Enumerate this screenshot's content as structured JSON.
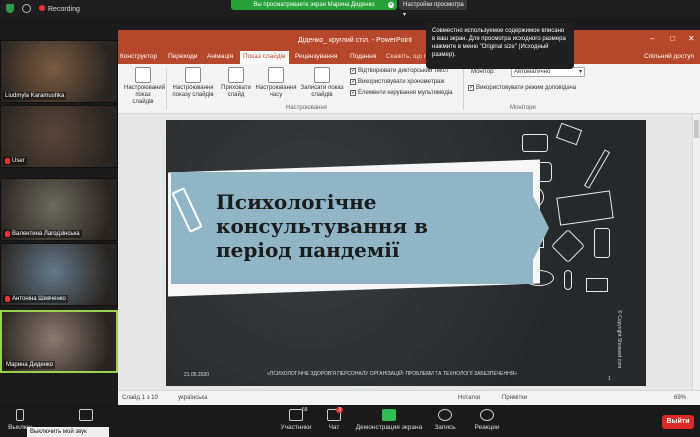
{
  "zoom_top": {
    "recording": "Recording",
    "share_notice": "Вы просматриваете экран Марина Диденко",
    "view_options": "Настройки просмотра"
  },
  "tooltip": "Совместно используемое содержимое вписано в ваш экран. Для просмотра исходного размера нажмите в меню \"Original size\" (Исходный размер).",
  "participants": [
    {
      "name": "Liudmyla Karamushka",
      "muted": false,
      "bg": "#7a5b42"
    },
    {
      "name": "User",
      "muted": true,
      "bg": "#5a4638"
    },
    {
      "name": "Валентина Лагодзінська",
      "muted": true,
      "bg": "#6c6a5e"
    },
    {
      "name": "Антоніна Шевченко",
      "muted": true,
      "bg": "#62798a"
    },
    {
      "name": "Марина Диденко",
      "muted": false,
      "bg": "#8c7a6e"
    }
  ],
  "ppt": {
    "title": "Діденко_ круглий стіл. - PowerPoint",
    "tabs": [
      "Конструктор",
      "Переходи",
      "Анімація",
      "Показ слайдів",
      "Рецензування",
      "Подання",
      "Скажіть, що потрібно зробити"
    ],
    "selected_tab": "Показ слайдів",
    "share": "Спільний доступ",
    "ribbon_buttons": [
      "Настроюваний показ слайдів",
      "Настроювання показу слайдів",
      "Приховати слайд",
      "Настроювання часу",
      "Записати показ слайдів"
    ],
    "checks": [
      {
        "label": "Відтворювати дикторський текст",
        "on": true
      },
      {
        "label": "Використовувати хронометраж",
        "on": true
      },
      {
        "label": "Елементи керування мультимедіа",
        "on": true
      }
    ],
    "monitor_label": "Монітор:",
    "monitor_value": "Автоматично",
    "presenter_view": "Використовувати режим доповідача",
    "group_setup": "Настроювання",
    "group_monitors": "Монітори",
    "status": {
      "slide": "Слайд 1 з 10",
      "lang": "українська",
      "notes": "Нотатки",
      "comments": "Примітки",
      "zoom": "69%"
    }
  },
  "slide": {
    "title_lines": [
      "Психологічне",
      "консультування в",
      "період пандемії"
    ],
    "date": "21.05.2020",
    "footer": "«ПСИХОЛОГІЧНЕ ЗДОРОВ'Я ПЕРСОНАЛУ ОРГАНІЗАЦІЙ: ПРОБЛЕМИ ТА ТЕХНОЛОГІЇ ЗАБЕЗПЕЧЕННЯ»",
    "number": "1",
    "copyright": "© Copyright Showeet.com"
  },
  "zoom_bottom": {
    "mute": "Выключ",
    "mute_tip": "Выключить мой звук (⌥⌘A)",
    "participants_count": "58",
    "participants": "Участники",
    "chat": "Чат",
    "chat_badge": "3",
    "share": "Демонстрация экрана",
    "record": "Запись",
    "reactions": "Реакции",
    "leave": "Выйти"
  }
}
